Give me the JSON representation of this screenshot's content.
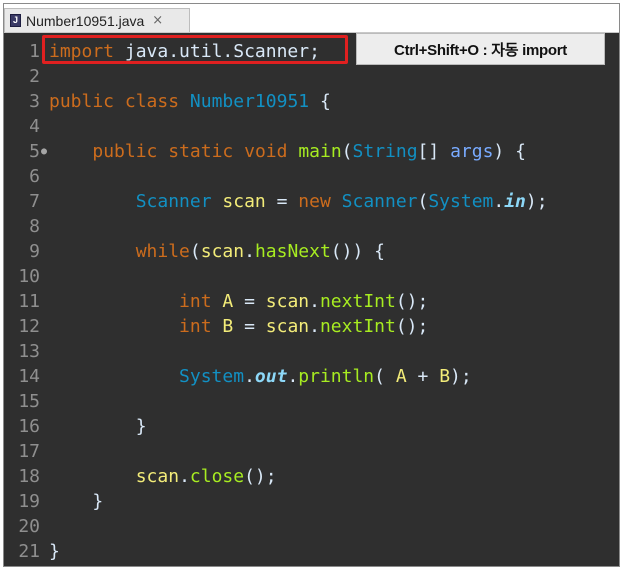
{
  "tab": {
    "title": "Number10951.java",
    "close": "×",
    "file_icon": "java-file-icon"
  },
  "annotation": {
    "label": "Ctrl+Shift+O : 자동 import",
    "highlight_color": "#e02020"
  },
  "editor": {
    "background": "#2f2f2f",
    "lines": [
      {
        "n": "1",
        "tokens": [
          [
            "kw",
            "import"
          ],
          [
            "plain",
            " java.util.Scanner;"
          ]
        ]
      },
      {
        "n": "2",
        "tokens": []
      },
      {
        "n": "3",
        "tokens": [
          [
            "kw",
            "public"
          ],
          [
            "plain",
            " "
          ],
          [
            "kw",
            "class"
          ],
          [
            "plain",
            " "
          ],
          [
            "cls",
            "Number10951"
          ],
          [
            "plain",
            " {"
          ]
        ]
      },
      {
        "n": "4",
        "tokens": []
      },
      {
        "n": "5",
        "marker": "●",
        "tokens": [
          [
            "plain",
            "    "
          ],
          [
            "kw",
            "public"
          ],
          [
            "plain",
            " "
          ],
          [
            "kw",
            "static"
          ],
          [
            "plain",
            " "
          ],
          [
            "kw",
            "void"
          ],
          [
            "plain",
            " "
          ],
          [
            "fn",
            "main"
          ],
          [
            "plain",
            "("
          ],
          [
            "cls",
            "String"
          ],
          [
            "plain",
            "[] "
          ],
          [
            "par",
            "args"
          ],
          [
            "plain",
            ") {"
          ]
        ]
      },
      {
        "n": "6",
        "tokens": []
      },
      {
        "n": "7",
        "tokens": [
          [
            "plain",
            "        "
          ],
          [
            "cls",
            "Scanner"
          ],
          [
            "plain",
            " "
          ],
          [
            "var",
            "scan"
          ],
          [
            "plain",
            " = "
          ],
          [
            "kw",
            "new"
          ],
          [
            "plain",
            " "
          ],
          [
            "cls",
            "Scanner"
          ],
          [
            "plain",
            "("
          ],
          [
            "cls",
            "System"
          ],
          [
            "plain",
            "."
          ],
          [
            "ital",
            "in"
          ],
          [
            "plain",
            ");"
          ]
        ]
      },
      {
        "n": "8",
        "tokens": []
      },
      {
        "n": "9",
        "tokens": [
          [
            "plain",
            "        "
          ],
          [
            "kw",
            "while"
          ],
          [
            "plain",
            "("
          ],
          [
            "var",
            "scan"
          ],
          [
            "plain",
            "."
          ],
          [
            "fn",
            "hasNext"
          ],
          [
            "plain",
            "()) {"
          ]
        ]
      },
      {
        "n": "10",
        "tokens": []
      },
      {
        "n": "11",
        "tokens": [
          [
            "plain",
            "            "
          ],
          [
            "kw",
            "int"
          ],
          [
            "plain",
            " "
          ],
          [
            "var",
            "A"
          ],
          [
            "plain",
            " = "
          ],
          [
            "var",
            "scan"
          ],
          [
            "plain",
            "."
          ],
          [
            "fn",
            "nextInt"
          ],
          [
            "plain",
            "();"
          ]
        ]
      },
      {
        "n": "12",
        "tokens": [
          [
            "plain",
            "            "
          ],
          [
            "kw",
            "int"
          ],
          [
            "plain",
            " "
          ],
          [
            "var",
            "B"
          ],
          [
            "plain",
            " = "
          ],
          [
            "var",
            "scan"
          ],
          [
            "plain",
            "."
          ],
          [
            "fn",
            "nextInt"
          ],
          [
            "plain",
            "();"
          ]
        ]
      },
      {
        "n": "13",
        "tokens": []
      },
      {
        "n": "14",
        "tokens": [
          [
            "plain",
            "            "
          ],
          [
            "cls",
            "System"
          ],
          [
            "plain",
            "."
          ],
          [
            "ital",
            "out"
          ],
          [
            "plain",
            "."
          ],
          [
            "fn",
            "println"
          ],
          [
            "plain",
            "( "
          ],
          [
            "var",
            "A"
          ],
          [
            "plain",
            " + "
          ],
          [
            "var",
            "B"
          ],
          [
            "plain",
            ");"
          ]
        ]
      },
      {
        "n": "15",
        "tokens": []
      },
      {
        "n": "16",
        "tokens": [
          [
            "plain",
            "        }"
          ]
        ]
      },
      {
        "n": "17",
        "tokens": []
      },
      {
        "n": "18",
        "tokens": [
          [
            "plain",
            "        "
          ],
          [
            "var",
            "scan"
          ],
          [
            "plain",
            "."
          ],
          [
            "fn",
            "close"
          ],
          [
            "plain",
            "();"
          ]
        ]
      },
      {
        "n": "19",
        "tokens": [
          [
            "plain",
            "    }"
          ]
        ]
      },
      {
        "n": "20",
        "tokens": []
      },
      {
        "n": "21",
        "tokens": [
          [
            "plain",
            "}"
          ]
        ]
      }
    ]
  }
}
